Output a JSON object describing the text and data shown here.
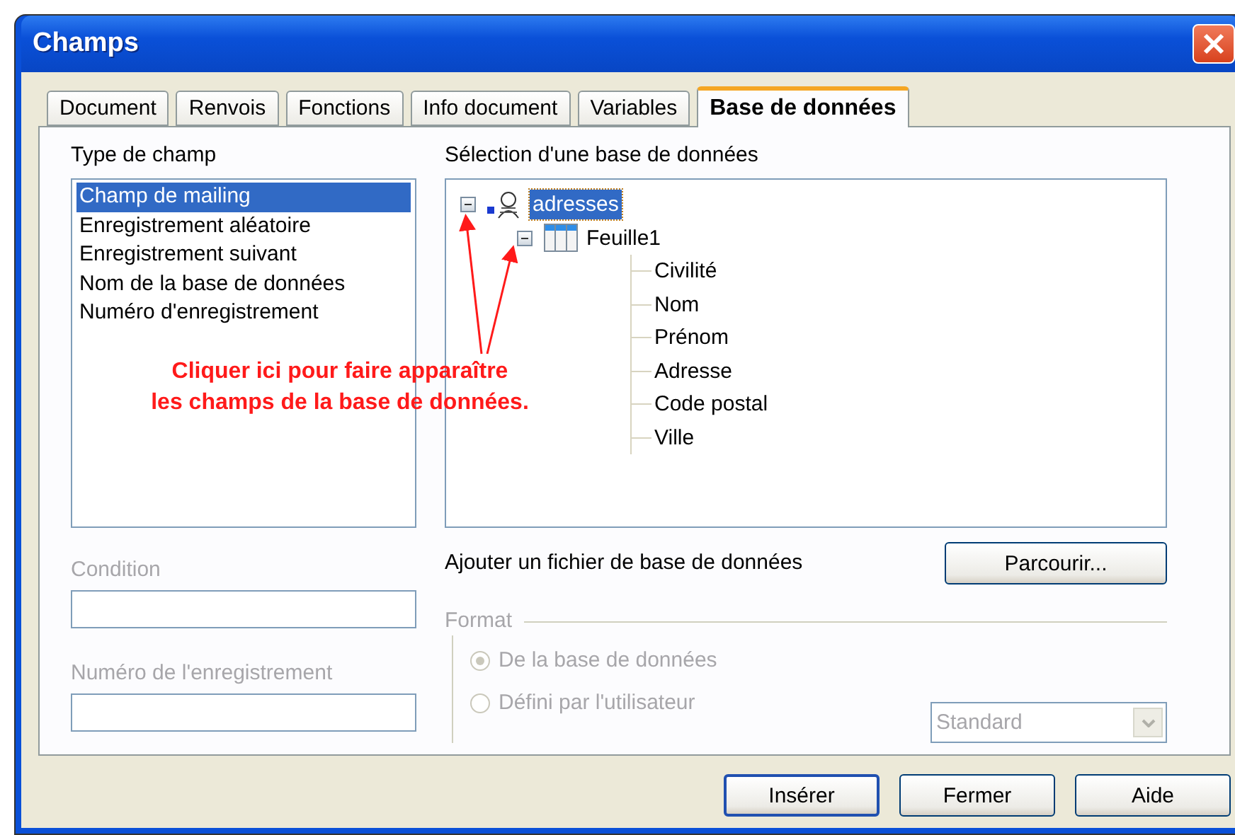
{
  "window": {
    "title": "Champs"
  },
  "tabs": [
    {
      "label": "Document",
      "selected": false
    },
    {
      "label": "Renvois",
      "selected": false
    },
    {
      "label": "Fonctions",
      "selected": false
    },
    {
      "label": "Info document",
      "selected": false
    },
    {
      "label": "Variables",
      "selected": false
    },
    {
      "label": "Base de données",
      "selected": true
    }
  ],
  "field_type": {
    "label": "Type de champ",
    "items": [
      {
        "label": "Champ de mailing",
        "selected": true
      },
      {
        "label": "Enregistrement aléatoire",
        "selected": false
      },
      {
        "label": "Enregistrement suivant",
        "selected": false
      },
      {
        "label": "Nom de la base de données",
        "selected": false
      },
      {
        "label": "Numéro d'enregistrement",
        "selected": false
      }
    ]
  },
  "database_selection": {
    "label": "Sélection d'une base de données",
    "tree": [
      {
        "label": "adresses",
        "kind": "database",
        "selected": true,
        "expanded": true,
        "children": [
          {
            "label": "Feuille1",
            "kind": "table",
            "selected": false,
            "expanded": true,
            "children": [
              {
                "label": "Civilité",
                "kind": "field",
                "selected": false
              },
              {
                "label": "Nom",
                "kind": "field",
                "selected": false
              },
              {
                "label": "Prénom",
                "kind": "field",
                "selected": false
              },
              {
                "label": "Adresse",
                "kind": "field",
                "selected": false
              },
              {
                "label": "Code postal",
                "kind": "field",
                "selected": false
              },
              {
                "label": "Ville",
                "kind": "field",
                "selected": false
              }
            ]
          }
        ]
      }
    ]
  },
  "annotation": {
    "lines": [
      "Cliquer ici pour faire apparaître",
      "les champs de la base de données."
    ]
  },
  "condition": {
    "label": "Condition",
    "disabled": true
  },
  "record_number": {
    "label": "Numéro de l'enregistrement",
    "disabled": true
  },
  "add_database": {
    "label": "Ajouter un fichier de base de données",
    "button": "Parcourir..."
  },
  "format": {
    "label": "Format",
    "disabled": true,
    "options": [
      {
        "label": "De la base de données",
        "selected": true
      },
      {
        "label": "Défini par l'utilisateur",
        "selected": false
      }
    ],
    "select": {
      "value": "Standard"
    }
  },
  "buttons": [
    {
      "label": "Insérer",
      "default": true
    },
    {
      "label": "Fermer",
      "default": false
    },
    {
      "label": "Aide",
      "default": false
    }
  ]
}
